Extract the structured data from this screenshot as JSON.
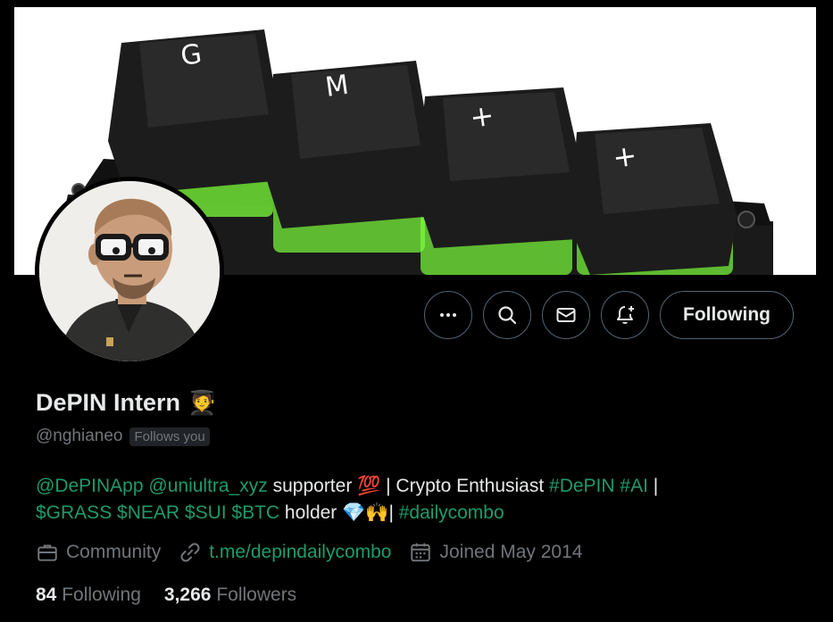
{
  "profile": {
    "display_name": "DePIN Intern",
    "name_emoji": "🧑‍🎓",
    "handle": "@nghianeo",
    "follows_you": "Follows you"
  },
  "actions": {
    "more_icon": "more-icon",
    "search_icon": "search-icon",
    "message_icon": "mail-icon",
    "notify_icon": "bell-plus-icon",
    "follow_label": "Following"
  },
  "bio": {
    "mention1": "@DePINApp",
    "mention2": "@uniultra_xyz",
    "text1": " supporter ",
    "emoji100": "💯",
    "text2": " | Crypto Enthusiast ",
    "tag_depin": "#DePIN",
    "tag_ai": "#AI",
    "text3": " |",
    "cashtags": "$GRASS $NEAR $SUI $BTC",
    "text4": " holder ",
    "emoji_hands": "💎🙌",
    "text5": "| ",
    "tag_daily": "#dailycombo"
  },
  "meta": {
    "category": "Community",
    "url": "t.me/depindailycombo",
    "joined": "Joined May 2014"
  },
  "stats": {
    "following_count": "84",
    "following_label": "Following",
    "followers_count": "3,266",
    "followers_label": "Followers"
  },
  "banner": {
    "keys": [
      "G",
      "M",
      "+",
      "+"
    ]
  },
  "colors": {
    "background": "#000000",
    "link": "#1d9b6c",
    "muted": "#71767b",
    "border": "#536471"
  }
}
